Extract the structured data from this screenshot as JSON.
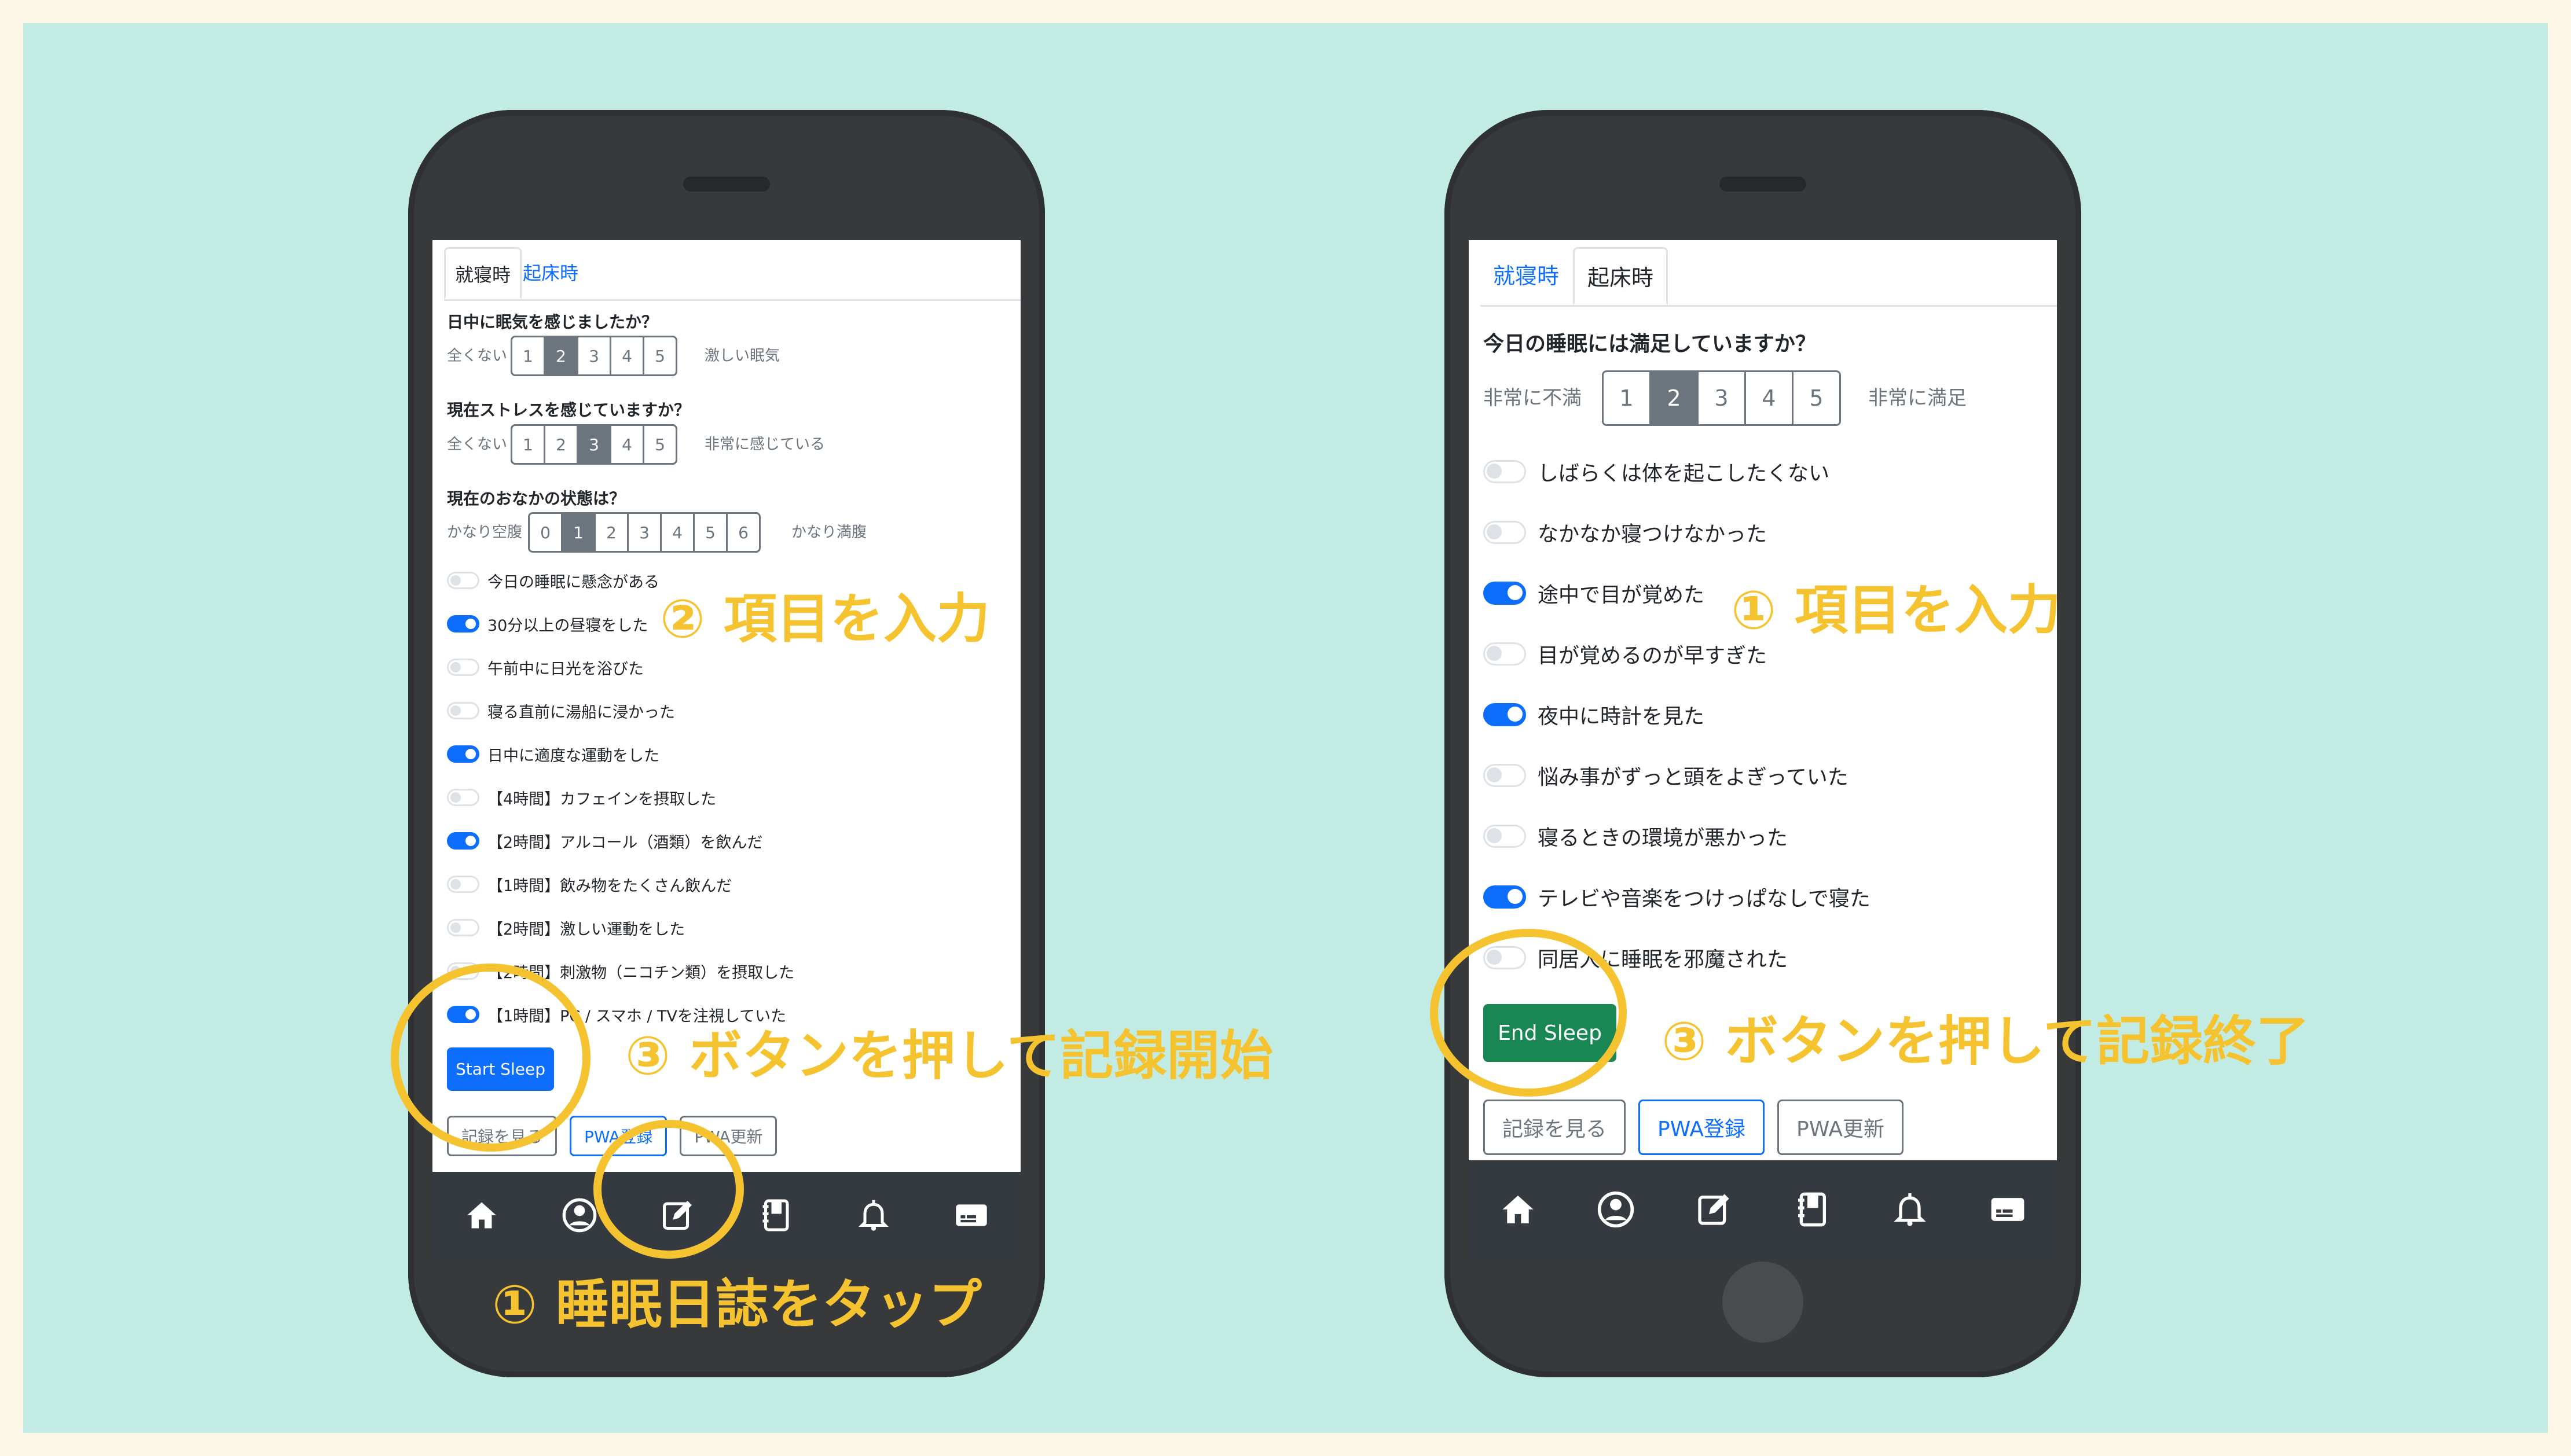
{
  "colors": {
    "accent_annotation": "#f6c330",
    "background": "#c2ece3",
    "primary": "#0d6efd",
    "success": "#198754"
  },
  "left": {
    "tabs": [
      {
        "label": "就寝時",
        "active": true
      },
      {
        "label": "起床時",
        "active": false
      }
    ],
    "questions": [
      {
        "title": "日中に眠気を感じましたか？",
        "low": "全くない",
        "high": "激しい眠気",
        "options": [
          "1",
          "2",
          "3",
          "4",
          "5"
        ],
        "selected": "2"
      },
      {
        "title": "現在ストレスを感じていますか？",
        "low": "全くない",
        "high": "非常に感じている",
        "options": [
          "1",
          "2",
          "3",
          "4",
          "5"
        ],
        "selected": "3"
      },
      {
        "title": "現在のおなかの状態は？",
        "low": "かなり空腹",
        "high": "かなり満腹",
        "options": [
          "0",
          "1",
          "2",
          "3",
          "4",
          "5",
          "6"
        ],
        "selected": "1"
      }
    ],
    "switches": [
      {
        "label": "今日の睡眠に懸念がある",
        "on": false
      },
      {
        "label": "30分以上の昼寝をした",
        "on": true
      },
      {
        "label": "午前中に日光を浴びた",
        "on": false
      },
      {
        "label": "寝る直前に湯船に浸かった",
        "on": false
      },
      {
        "label": "日中に適度な運動をした",
        "on": true
      },
      {
        "label": "【4時間】カフェインを摂取した",
        "on": false
      },
      {
        "label": "【2時間】アルコール（酒類）を飲んだ",
        "on": true
      },
      {
        "label": "【1時間】飲み物をたくさん飲んだ",
        "on": false
      },
      {
        "label": "【2時間】激しい運動をした",
        "on": false
      },
      {
        "label": "【2時間】刺激物（ニコチン類）を摂取した",
        "on": false
      },
      {
        "label": "【1時間】PC / スマホ / TVを注視していた",
        "on": true
      }
    ],
    "start_button": "Start Sleep",
    "buttons": [
      "記録を見る",
      "PWA登録",
      "PWA更新"
    ],
    "nav_icons": [
      "home-icon",
      "profile-icon",
      "edit-icon",
      "notebook-icon",
      "bell-icon",
      "card-icon"
    ]
  },
  "right": {
    "tabs": [
      {
        "label": "就寝時",
        "active": false
      },
      {
        "label": "起床時",
        "active": true
      }
    ],
    "question": {
      "title": "今日の睡眠には満足していますか？",
      "low": "非常に不満",
      "high": "非常に満足",
      "options": [
        "1",
        "2",
        "3",
        "4",
        "5"
      ],
      "selected": "2"
    },
    "switches": [
      {
        "label": "しばらくは体を起こしたくない",
        "on": false
      },
      {
        "label": "なかなか寝つけなかった",
        "on": false
      },
      {
        "label": "途中で目が覚めた",
        "on": true
      },
      {
        "label": "目が覚めるのが早すぎた",
        "on": false
      },
      {
        "label": "夜中に時計を見た",
        "on": true
      },
      {
        "label": "悩み事がずっと頭をよぎっていた",
        "on": false
      },
      {
        "label": "寝るときの環境が悪かった",
        "on": false
      },
      {
        "label": "テレビや音楽をつけっぱなしで寝た",
        "on": true
      },
      {
        "label": "同居人に睡眠を邪魔された",
        "on": false
      }
    ],
    "end_button": "End Sleep",
    "buttons": [
      "記録を見る",
      "PWA登録",
      "PWA更新"
    ],
    "nav_icons": [
      "home-icon",
      "profile-icon",
      "edit-icon",
      "notebook-icon",
      "bell-icon",
      "card-icon"
    ]
  },
  "annotations": {
    "left_step1": "① 睡眠日誌をタップ",
    "left_step2": "② 項目を入力",
    "left_step3": "③ ボタンを押して記録開始",
    "right_step1": "① 項目を入力",
    "right_step3": "③ ボタンを押して記録終了"
  }
}
